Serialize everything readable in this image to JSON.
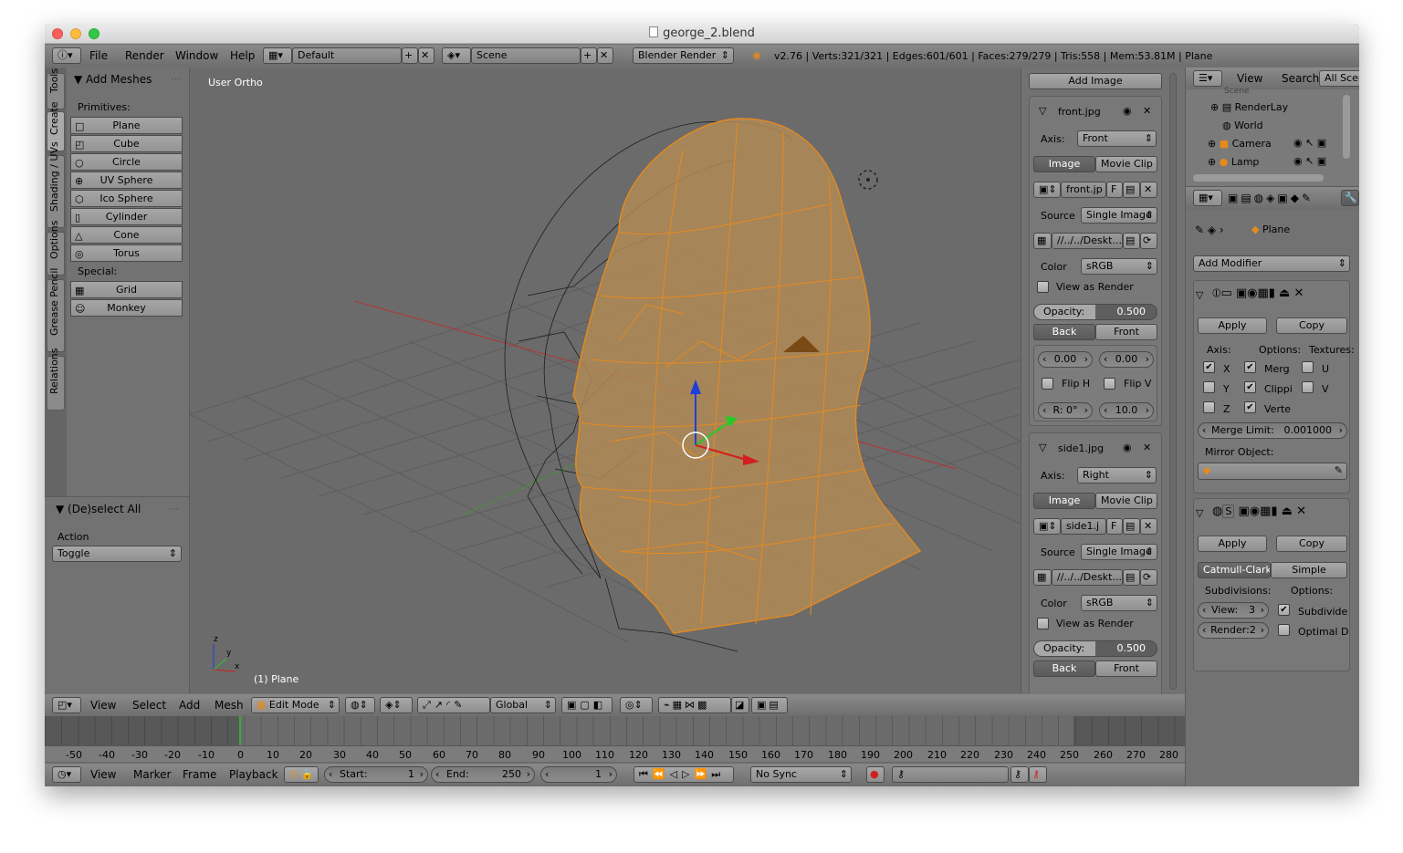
{
  "window": {
    "title": "george_2.blend"
  },
  "topbar": {
    "menus": [
      "File",
      "Render",
      "Window",
      "Help"
    ],
    "layout": "Default",
    "scene": "Scene",
    "engine": "Blender Render",
    "stats": "v2.76 | Verts:321/321 | Edges:601/601 | Faces:279/279 | Tris:558 | Mem:53.81M | Plane"
  },
  "toolshelf": {
    "tabs": [
      "Tools",
      "Create",
      "Shading / UVs",
      "Options",
      "Grease Pencil",
      "Relations"
    ],
    "panel_title": "Add Meshes",
    "primitives_label": "Primitives:",
    "primitives": [
      "Plane",
      "Cube",
      "Circle",
      "UV Sphere",
      "Ico Sphere",
      "Cylinder",
      "Cone",
      "Torus"
    ],
    "special_label": "Special:",
    "special": [
      "Grid",
      "Monkey"
    ],
    "op_title": "(De)select All",
    "action_label": "Action",
    "action_value": "Toggle"
  },
  "viewport": {
    "view_label": "User Ortho",
    "object_label": "(1) Plane",
    "axis_labels": [
      "z",
      "y",
      "x"
    ]
  },
  "bgimages": {
    "add_button": "Add Image",
    "images": [
      {
        "name": "front.jpg",
        "axis_label": "Axis:",
        "axis": "Front",
        "tab_image": "Image",
        "tab_clip": "Movie Clip",
        "file": "front.jp",
        "f": "F",
        "source_label": "Source",
        "source": "Single Image",
        "path": "//../../Deskt...",
        "color_label": "Color",
        "color": "sRGB",
        "view_as_render": "View as Render",
        "opacity_label": "Opacity:",
        "opacity": "0.500",
        "back": "Back",
        "front": "Front",
        "offset_x": "0.00",
        "offset_y": "0.00",
        "flip_h": "Flip H",
        "flip_v": "Flip V",
        "rot": "R: 0°",
        "size": "10.0"
      },
      {
        "name": "side1.jpg",
        "axis_label": "Axis:",
        "axis": "Right",
        "tab_image": "Image",
        "tab_clip": "Movie Clip",
        "file": "side1.j",
        "f": "F",
        "source_label": "Source",
        "source": "Single Image",
        "path": "//../../Deskt...",
        "color_label": "Color",
        "color": "sRGB",
        "view_as_render": "View as Render",
        "opacity_label": "Opacity:",
        "opacity": "0.500",
        "back": "Back",
        "front": "Front"
      }
    ]
  },
  "outliner": {
    "menus": [
      "View",
      "Search"
    ],
    "filter": "All Scer",
    "items": [
      "Scene",
      "RenderLay",
      "World",
      "Camera",
      "Lamp"
    ]
  },
  "properties": {
    "breadcrumb": "Plane",
    "add_modifier": "Add Modifier",
    "mirror": {
      "apply": "Apply",
      "copy": "Copy",
      "axis_label": "Axis:",
      "options_label": "Options:",
      "textures_label": "Textures:",
      "axes": [
        "X",
        "Y",
        "Z"
      ],
      "axes_checked": [
        true,
        false,
        false
      ],
      "options": [
        "Merg",
        "Clippi",
        "Verte"
      ],
      "textures": [
        "U",
        "V"
      ],
      "merge_limit_label": "Merge Limit:",
      "merge_limit": "0.001000",
      "mirror_object_label": "Mirror Object:"
    },
    "subsurf": {
      "name": "S",
      "apply": "Apply",
      "copy": "Copy",
      "type_cc": "Catmull-Clark",
      "type_simple": "Simple",
      "subdiv_label": "Subdivisions:",
      "options_label": "Options:",
      "view": "View:",
      "view_val": "3",
      "render": "Render:2",
      "subdivide_uvs": "Subdivide",
      "optimal": "Optimal D"
    }
  },
  "view3d_header": {
    "menus": [
      "View",
      "Select",
      "Add",
      "Mesh"
    ],
    "mode": "Edit Mode",
    "orientation": "Global"
  },
  "timeline": {
    "ticks": [
      "-50",
      "-40",
      "-30",
      "-20",
      "-10",
      "0",
      "10",
      "20",
      "30",
      "40",
      "50",
      "60",
      "70",
      "80",
      "90",
      "100",
      "110",
      "120",
      "130",
      "140",
      "150",
      "160",
      "170",
      "180",
      "190",
      "200",
      "210",
      "220",
      "230",
      "240",
      "250",
      "260",
      "270",
      "280"
    ],
    "current_frame": 1,
    "menus": [
      "View",
      "Marker",
      "Frame",
      "Playback"
    ],
    "start_label": "Start:",
    "start": "1",
    "end_label": "End:",
    "end": "250",
    "frame": "1",
    "sync": "No Sync"
  },
  "colors": {
    "accent": "#e68a1e",
    "selected_tab": "#5a5a5a",
    "viewport_bg": "#6b6b6b"
  }
}
